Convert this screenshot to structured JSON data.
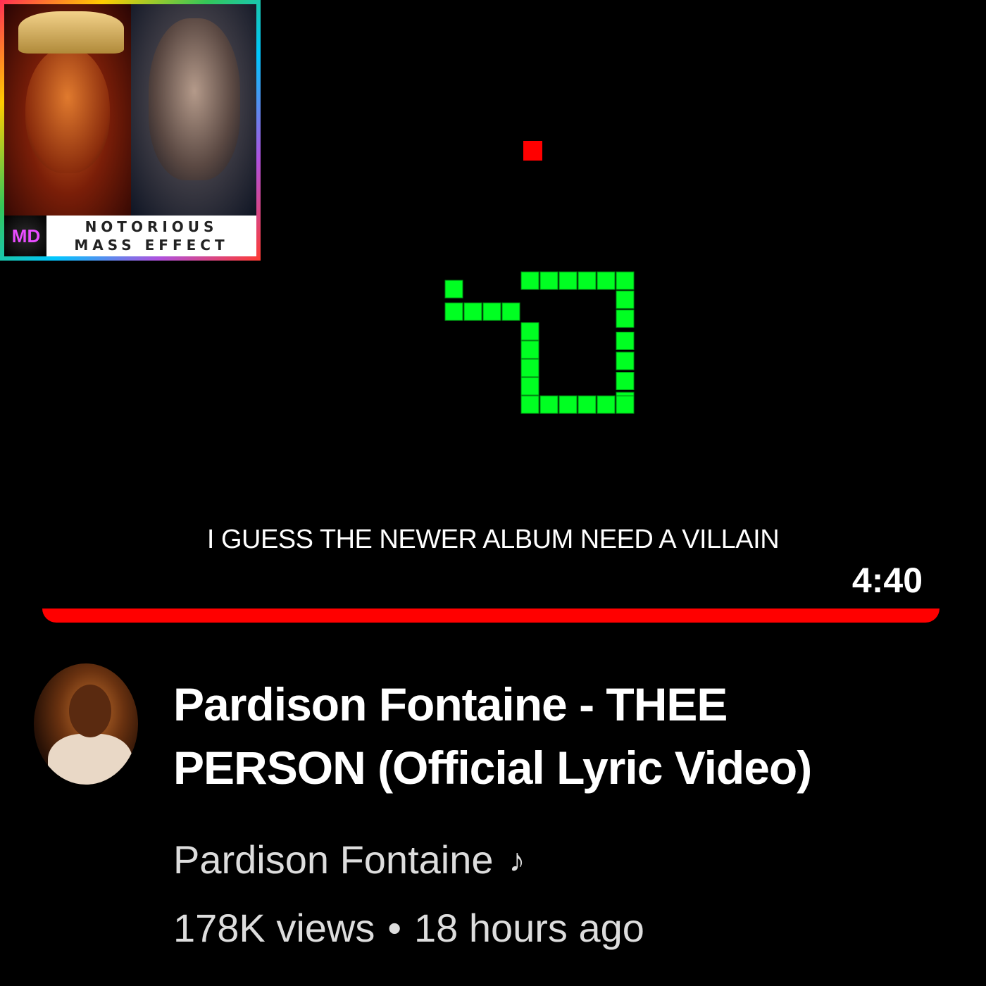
{
  "album_art": {
    "line1": "NOTORIOUS",
    "line2": "MASS EFFECT",
    "logo": "MD"
  },
  "video": {
    "lyric": "I GUESS THE NEWER ALBUM NEED A VILLAIN",
    "duration": "4:40",
    "progress_fraction": 1.0,
    "snake_color": "#00ff22",
    "food_color": "#ff0000",
    "accent_color": "#ff0000"
  },
  "info": {
    "title": "Pardison Fontaine - THEE PERSON (Official Lyric Video)",
    "channel": "Pardison Fontaine",
    "channel_badge_icon": "music-note-icon",
    "views": "178K views",
    "separator": "•",
    "age": "18 hours ago"
  }
}
